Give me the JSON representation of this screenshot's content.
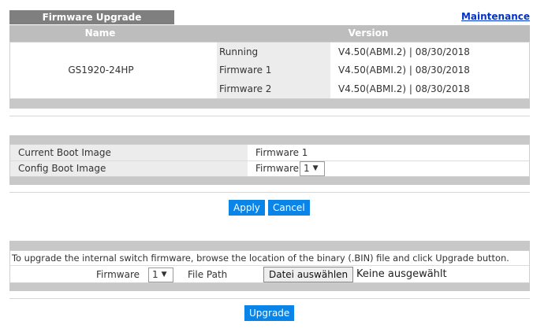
{
  "header": {
    "title": "Firmware Upgrade",
    "maintenance_link": "Maintenance"
  },
  "firmware_table": {
    "col_name": "Name",
    "col_version": "Version",
    "device_name": "GS1920-24HP",
    "rows": [
      {
        "label": "Running",
        "version": "V4.50(ABMI.2) | 08/30/2018"
      },
      {
        "label": "Firmware 1",
        "version": "V4.50(ABMI.2) | 08/30/2018"
      },
      {
        "label": "Firmware 2",
        "version": "V4.50(ABMI.2) | 08/30/2018"
      }
    ]
  },
  "boot": {
    "current_label": "Current Boot Image",
    "current_value": "Firmware 1",
    "config_label": "Config Boot Image",
    "config_prefix": "Firmware",
    "config_selected": "1"
  },
  "actions": {
    "apply": "Apply",
    "cancel": "Cancel"
  },
  "upgrade": {
    "instruction": "To upgrade the internal switch firmware, browse the location of the binary (.BIN) file and click Upgrade button.",
    "firmware_label": "Firmware",
    "firmware_selected": "1",
    "file_path_label": "File Path",
    "choose_file": "Datei auswählen",
    "no_file": "Keine ausgewählt",
    "upgrade_button": "Upgrade"
  }
}
